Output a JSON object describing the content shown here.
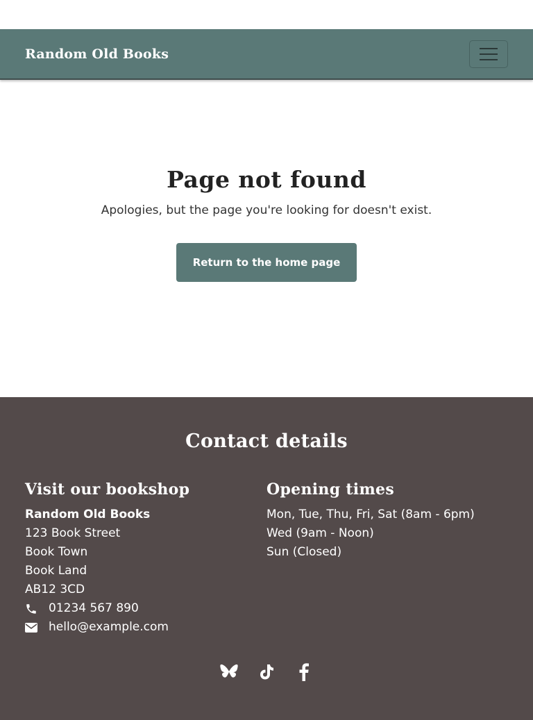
{
  "header": {
    "brand": "Random Old Books",
    "menu_icon": "hamburger-menu-icon"
  },
  "main": {
    "title": "Page not found",
    "message": "Apologies, but the page you're looking for doesn't exist.",
    "home_button_label": "Return to the home page"
  },
  "footer": {
    "heading": "Contact details",
    "visit": {
      "heading": "Visit our bookshop",
      "name": "Random Old Books",
      "address_lines": [
        "123 Book Street",
        "Book Town",
        "Book Land",
        "AB12 3CD"
      ],
      "phone": "01234 567 890",
      "phone_icon": "phone-icon",
      "email": "hello@example.com",
      "email_icon": "envelope-icon"
    },
    "opening": {
      "heading": "Opening times",
      "lines": [
        "Mon, Tue, Thu, Fri, Sat (8am - 6pm)",
        "Wed (9am - Noon)",
        "Sun (Closed)"
      ]
    },
    "social_icons": [
      "bluesky-icon",
      "tiktok-icon",
      "facebook-icon"
    ]
  },
  "colors": {
    "brand": "#5a7977",
    "footer_bg": "#534a4a",
    "text_dark": "#222222",
    "white": "#ffffff"
  }
}
